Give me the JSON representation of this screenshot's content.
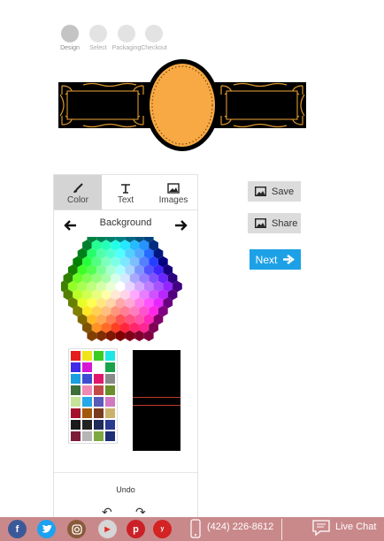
{
  "steps": [
    {
      "label": "Design",
      "active": true
    },
    {
      "label": "Select",
      "active": false
    },
    {
      "label": "Packaging",
      "active": false
    },
    {
      "label": "Checkout",
      "active": false
    }
  ],
  "tabs": [
    {
      "label": "Color",
      "icon": "brush-icon"
    },
    {
      "label": "Text",
      "icon": "text-icon"
    },
    {
      "label": "Images",
      "icon": "image-icon"
    }
  ],
  "section_title": "Background",
  "undo_label": "Undo",
  "buttons": {
    "save": "Save",
    "share": "Share",
    "next": "Next"
  },
  "footer": {
    "phone": "(424) 226-8612",
    "live_chat": "Live Chat"
  },
  "palette_swatches": [
    "#e41c1c",
    "#f2e41b",
    "#3acb23",
    "#1ce6e6",
    "#3f2be8",
    "#d418d4",
    "#ffffff",
    "#19a34a",
    "#1b9fe0",
    "#3d4fd0",
    "#e0186c",
    "#8a8a8a",
    "#3d6f3a",
    "#ef8ab4",
    "#c44a4a",
    "#6a8e2a",
    "#c6e39a",
    "#26a7e8",
    "#5a5ab8",
    "#d278c0",
    "#a4122a",
    "#a45a0e",
    "#7a3a1e",
    "#c9b26a",
    "#1a1a1a",
    "#222222",
    "#1e2a5a",
    "#2a3a8e",
    "#7a1c3a",
    "#b6b6b6",
    "#7ea842",
    "#1e2f74"
  ],
  "colors": {
    "accent": "#1da1e6",
    "label_gold": "#f8a944",
    "footer": "#c9898b"
  }
}
